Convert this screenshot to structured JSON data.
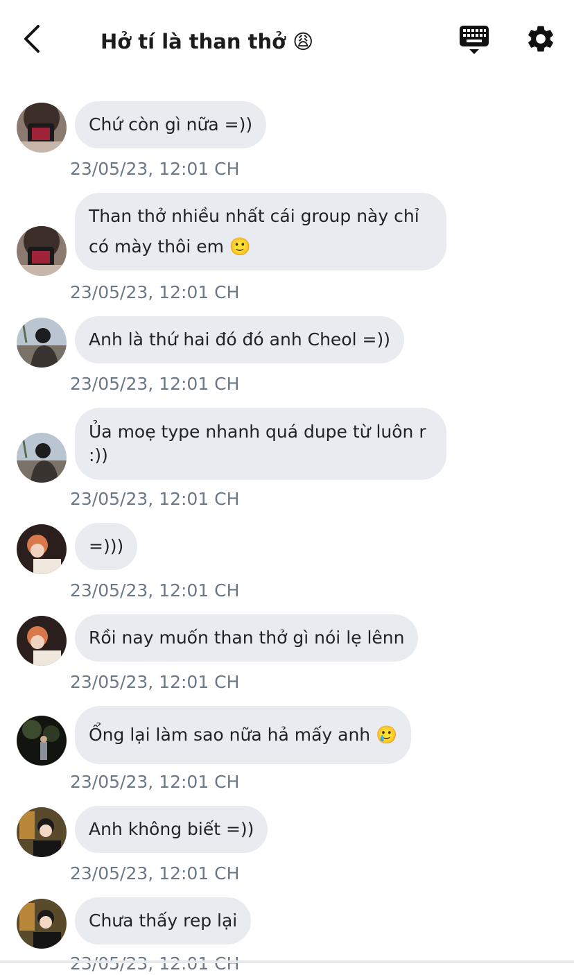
{
  "header": {
    "title": "Hở tí là than thở 😩",
    "back_icon": "chevron-left-icon",
    "keyboard_icon": "keyboard-hide-icon",
    "settings_icon": "gear-icon"
  },
  "messages": [
    {
      "avatar": "avatar-1",
      "text": "Chứ còn gì nữa =))",
      "time": "23/05/23, 12:01 CH"
    },
    {
      "avatar": "avatar-1",
      "text": "Than thở nhiều nhất cái group này chỉ có mày thôi em 🙂",
      "time": "23/05/23, 12:01 CH"
    },
    {
      "avatar": "avatar-2",
      "text": "Anh là thứ hai đó đó anh Cheol =))",
      "time": "23/05/23, 12:01 CH"
    },
    {
      "avatar": "avatar-2",
      "text": "Ủa moẹ type nhanh quá dupe từ luôn r :))",
      "time": "23/05/23, 12:01 CH"
    },
    {
      "avatar": "avatar-3",
      "text": "=)))",
      "time": "23/05/23, 12:01 CH"
    },
    {
      "avatar": "avatar-3",
      "text": "Rồi nay muốn than thở gì nói lẹ lênn",
      "time": "23/05/23, 12:01 CH"
    },
    {
      "avatar": "avatar-4",
      "text": "Ổng lại làm sao nữa hả mấy anh 🥲",
      "time": "23/05/23, 12:01 CH"
    },
    {
      "avatar": "avatar-5",
      "text": "Anh không biết =))",
      "time": "23/05/23, 12:01 CH"
    },
    {
      "avatar": "avatar-5",
      "text": "Chưa thấy rep lại",
      "time": "23/05/23, 12:01 CH"
    }
  ],
  "colors": {
    "bubble": "#e8ebf0",
    "timestamp": "#6b7886",
    "text": "#1f2329"
  }
}
